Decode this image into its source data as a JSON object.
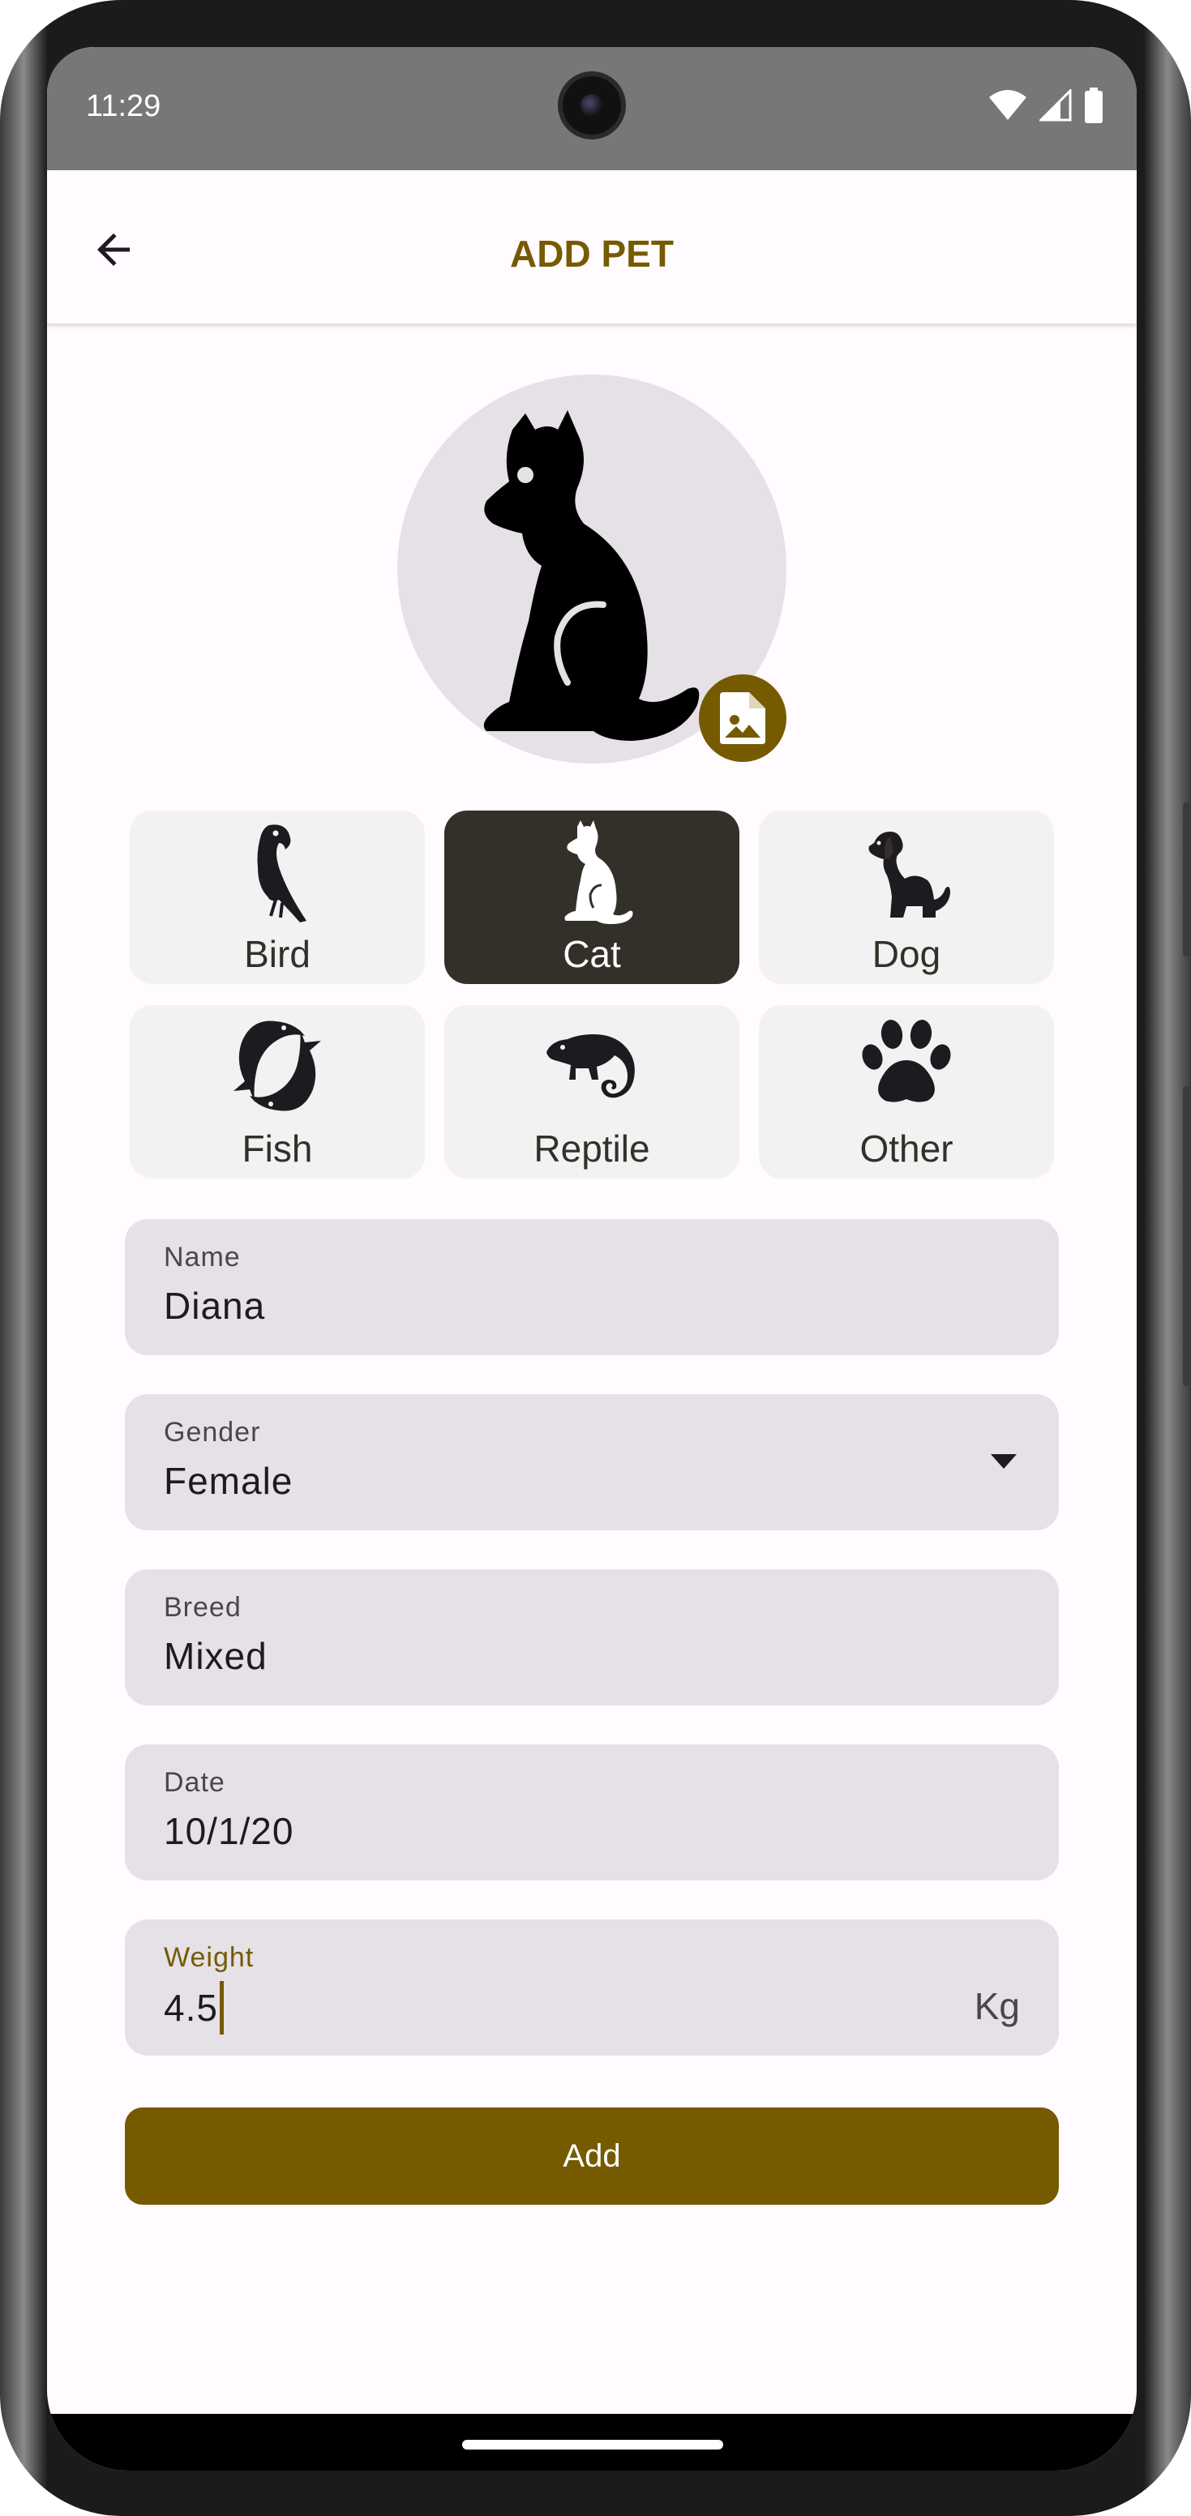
{
  "status_bar": {
    "time": "11:29"
  },
  "app_bar": {
    "title": "ADD PET",
    "back_icon": "arrow-back-icon"
  },
  "pet_photo": {
    "avatar_icon": "cat-silhouette-icon",
    "edit_icon": "image-file-icon"
  },
  "pet_types": [
    {
      "label": "Bird",
      "icon": "parrot-icon",
      "selected": false
    },
    {
      "label": "Cat",
      "icon": "cat-icon",
      "selected": true
    },
    {
      "label": "Dog",
      "icon": "dog-icon",
      "selected": false
    },
    {
      "label": "Fish",
      "icon": "fish-icon",
      "selected": false
    },
    {
      "label": "Reptile",
      "icon": "chameleon-icon",
      "selected": false
    },
    {
      "label": "Other",
      "icon": "paw-icon",
      "selected": false
    }
  ],
  "form": {
    "name": {
      "label": "Name",
      "value": "Diana"
    },
    "gender": {
      "label": "Gender",
      "value": "Female"
    },
    "breed": {
      "label": "Breed",
      "value": "Mixed"
    },
    "date": {
      "label": "Date",
      "value": "10/1/20"
    },
    "weight": {
      "label": "Weight",
      "value": "4.5",
      "suffix": "Kg"
    }
  },
  "actions": {
    "add_label": "Add"
  },
  "colors": {
    "primary": "#755a00",
    "selected_chip": "#33302a",
    "chip": "#f2f2f2",
    "field": "#e5e1e6",
    "background": "#fffbfe"
  }
}
